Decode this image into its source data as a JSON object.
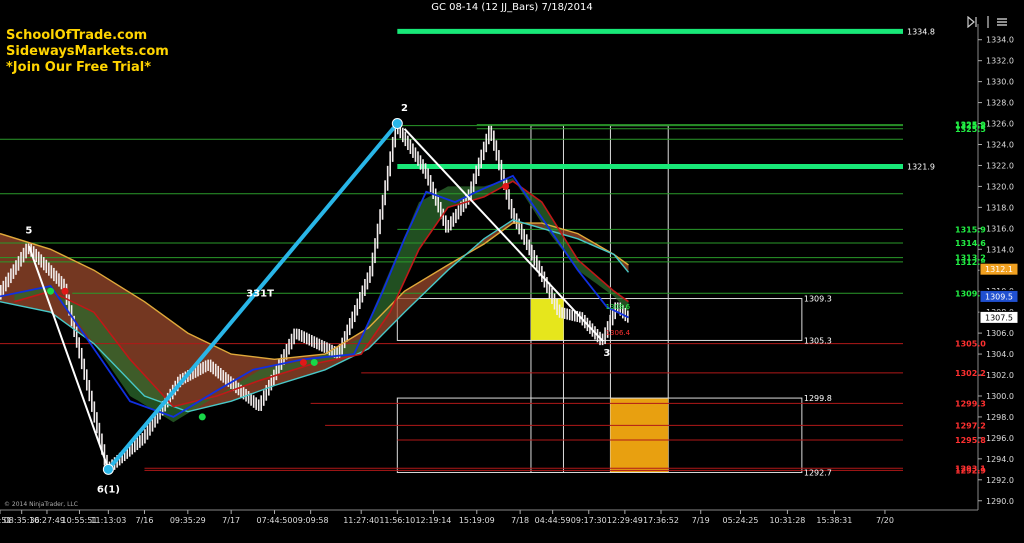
{
  "window": {
    "title": "GC 08-14 (12 JJ_Bars) 7/18/2014"
  },
  "promo": {
    "line1": "SchoolOfTrade.com",
    "line2": "SidewaysMarkets.com",
    "line3": "*Join Our Free Trial*"
  },
  "copyright": "© 2014 NinjaTrader, LLC",
  "toolbar_icons": [
    "play-bar-icon",
    "split-icon",
    "menu-icon"
  ],
  "colors": {
    "background": "#000000",
    "bar": "#f2eded",
    "price_line_white": "#ffffff",
    "wave_blue": "#29b6e8",
    "ribbon_band": "#9b4a2c",
    "envelope_upper": "#e0a93a",
    "envelope_lower": "#48c8c8",
    "fast_ma_red": "#c01818",
    "fast_ma_blue": "#1030e0",
    "green_level": "#18e878",
    "resistance_line": "#2a9a2a",
    "support_line": "#b01818",
    "supply_zone": "#e6e61c",
    "demand_zone": "#e8a010"
  },
  "chart_data": {
    "type": "line",
    "title": "GC 08-14 (12 JJ_Bars) 7/18/2014",
    "xlabel": "",
    "ylabel": "",
    "ylim": [
      1289.5,
      1335.5
    ],
    "y_ticks": [
      1290.0,
      1292.0,
      1294.0,
      1296.0,
      1298.0,
      1300.0,
      1302.0,
      1304.0,
      1306.0,
      1308.0,
      1310.0,
      1312.0,
      1314.0,
      1316.0,
      1318.0,
      1320.0,
      1322.0,
      1324.0,
      1326.0,
      1328.0,
      1330.0,
      1332.0,
      1334.0
    ],
    "x_tick_labels": [
      "56:51",
      "08:35:36",
      "10:27:49",
      "10:55:51",
      "11:13:03",
      "7/16",
      "09:35:29",
      "7/17",
      "07:44:50",
      "09:09:58",
      "11:27:40",
      "11:56:10",
      "12:19:14",
      "15:19:09",
      "7/18",
      "04:44:59",
      "09:17:30",
      "12:29:49",
      "17:36:52",
      "7/19",
      "05:24:25",
      "10:31:28",
      "15:38:31",
      "7/20"
    ],
    "x_tick_index": [
      0,
      6,
      13,
      22,
      30,
      40,
      52,
      64,
      76,
      86,
      100,
      110,
      120,
      132,
      144,
      153,
      163,
      173,
      183,
      194,
      205,
      218,
      231,
      245
    ],
    "x_range": [
      0,
      250
    ],
    "grid": false,
    "legend": "none",
    "series": [
      {
        "points": [
          [
            0,
            1309.7
          ],
          [
            8,
            1314.2
          ],
          [
            18,
            1310.5
          ],
          [
            30,
            1293.0
          ],
          [
            40,
            1296.0
          ],
          [
            50,
            1301.5
          ],
          [
            58,
            1303.0
          ],
          [
            72,
            1299.0
          ],
          [
            82,
            1306.0
          ],
          [
            94,
            1304.0
          ],
          [
            103,
            1312.0
          ],
          [
            110,
            1325.8
          ],
          [
            118,
            1321.5
          ],
          [
            124,
            1316.0
          ],
          [
            130,
            1319.0
          ],
          [
            136,
            1325.5
          ],
          [
            142,
            1317.5
          ],
          [
            149,
            1312.5
          ],
          [
            155,
            1308.0
          ],
          [
            161,
            1307.5
          ],
          [
            167,
            1305.2
          ],
          [
            171,
            1308.6
          ],
          [
            174,
            1307.5
          ]
        ]
      },
      {
        "points": [
          [
            4,
            1309.8
          ],
          [
            14,
            1310.5
          ],
          [
            26,
            1305.0
          ],
          [
            36,
            1300.0
          ],
          [
            48,
            1297.5
          ],
          [
            60,
            1300.0
          ],
          [
            72,
            1302.5
          ],
          [
            86,
            1303.5
          ],
          [
            100,
            1305.5
          ],
          [
            108,
            1312.0
          ],
          [
            116,
            1318.5
          ],
          [
            124,
            1320.0
          ],
          [
            134,
            1320.0
          ],
          [
            142,
            1320.8
          ],
          [
            150,
            1316.5
          ],
          [
            160,
            1312.0
          ],
          [
            170,
            1309.5
          ],
          [
            174,
            1308.0
          ]
        ]
      },
      {
        "points": [
          [
            4,
            1309.0
          ],
          [
            14,
            1310.0
          ],
          [
            26,
            1308.0
          ],
          [
            36,
            1303.5
          ],
          [
            48,
            1299.0
          ],
          [
            60,
            1300.0
          ],
          [
            72,
            1301.5
          ],
          [
            86,
            1303.0
          ],
          [
            100,
            1304.0
          ],
          [
            108,
            1308.0
          ],
          [
            116,
            1314.0
          ],
          [
            124,
            1318.0
          ],
          [
            134,
            1319.0
          ],
          [
            142,
            1320.5
          ],
          [
            150,
            1318.5
          ],
          [
            160,
            1313.0
          ],
          [
            170,
            1310.0
          ],
          [
            174,
            1309.0
          ]
        ]
      },
      {
        "points": [
          [
            0,
            1315.5
          ],
          [
            14,
            1314.0
          ],
          [
            26,
            1312.0
          ],
          [
            40,
            1309.0
          ],
          [
            52,
            1306.0
          ],
          [
            64,
            1304.0
          ],
          [
            76,
            1303.5
          ],
          [
            90,
            1304.0
          ],
          [
            102,
            1306.5
          ],
          [
            112,
            1310.0
          ],
          [
            124,
            1312.5
          ],
          [
            134,
            1314.5
          ],
          [
            142,
            1316.5
          ],
          [
            150,
            1316.5
          ],
          [
            160,
            1315.5
          ],
          [
            170,
            1313.5
          ],
          [
            174,
            1312.5
          ]
        ]
      },
      {
        "points": [
          [
            0,
            1309.0
          ],
          [
            14,
            1308.0
          ],
          [
            26,
            1305.0
          ],
          [
            40,
            1300.0
          ],
          [
            52,
            1298.5
          ],
          [
            64,
            1299.5
          ],
          [
            76,
            1301.0
          ],
          [
            90,
            1302.5
          ],
          [
            102,
            1304.5
          ],
          [
            112,
            1308.0
          ],
          [
            124,
            1312.0
          ],
          [
            134,
            1315.0
          ],
          [
            142,
            1316.8
          ],
          [
            150,
            1316.0
          ],
          [
            160,
            1315.0
          ],
          [
            170,
            1313.5
          ],
          [
            174,
            1311.8
          ]
        ]
      },
      {
        "points": [
          [
            0,
            1309.5
          ],
          [
            14,
            1310.5
          ],
          [
            24,
            1305.5
          ],
          [
            36,
            1299.5
          ],
          [
            48,
            1298.0
          ],
          [
            60,
            1300.5
          ],
          [
            70,
            1302.5
          ],
          [
            84,
            1303.5
          ],
          [
            98,
            1304.0
          ],
          [
            106,
            1310.0
          ],
          [
            112,
            1315.0
          ],
          [
            118,
            1319.5
          ],
          [
            126,
            1318.5
          ],
          [
            132,
            1319.5
          ],
          [
            142,
            1321.0
          ],
          [
            150,
            1317.0
          ],
          [
            160,
            1312.0
          ],
          [
            168,
            1308.5
          ],
          [
            174,
            1307.5
          ]
        ]
      },
      {
        "points": [
          [
            8,
            1314.3
          ],
          [
            30,
            1293.0
          ]
        ]
      },
      {
        "points": [
          [
            30,
            1293.0
          ],
          [
            110,
            1326.0
          ]
        ]
      },
      {
        "points": [
          [
            112,
            1325.5
          ],
          [
            167,
            1305.2
          ]
        ]
      }
    ],
    "annotations": [
      {
        "text": "5",
        "x": 8,
        "y": 1315.5
      },
      {
        "text": "6(1)",
        "x": 30,
        "y": 1290.8
      },
      {
        "text": "331T",
        "x": 72,
        "y": 1309.5
      },
      {
        "text": "2",
        "x": 112,
        "y": 1327.2
      },
      {
        "text": "3",
        "x": 168,
        "y": 1303.8
      }
    ],
    "levels": [
      {
        "value": 1334.8,
        "label": "1334.8",
        "start": 110
      },
      {
        "value": 1321.9,
        "label": "1321.9",
        "start": 110
      }
    ],
    "horizontal_lines": [
      {
        "value": 1325.8,
        "start": 110,
        "label": "1325.8"
      },
      {
        "value": 1325.5,
        "start": 132,
        "label": "1325.5"
      },
      {
        "value": 1325.9,
        "start": 132,
        "label": "1325.9"
      },
      {
        "value": 1324.5,
        "start": 0,
        "label": ""
      },
      {
        "value": 1319.3,
        "start": 0,
        "label": ""
      },
      {
        "value": 1315.9,
        "start": 110,
        "label": "1315.9"
      },
      {
        "value": 1314.6,
        "start": 0,
        "label": "1314.6"
      },
      {
        "value": 1313.2,
        "start": 0,
        "label": "1313.2"
      },
      {
        "value": 1312.8,
        "start": 0,
        "label": "1312.8"
      },
      {
        "value": 1309.8,
        "start": 20,
        "label": "1309.8"
      },
      {
        "value": 1305.0,
        "start": 0,
        "label": "1305.0"
      },
      {
        "value": 1302.2,
        "start": 100,
        "label": "1302.2"
      },
      {
        "value": 1299.3,
        "start": 86,
        "label": "1299.3"
      },
      {
        "value": 1297.2,
        "start": 90,
        "label": "1297.2"
      },
      {
        "value": 1295.8,
        "start": 110,
        "label": "1295.8"
      },
      {
        "value": 1293.1,
        "start": 40,
        "label": "1293.1"
      },
      {
        "value": 1292.9,
        "start": 40,
        "label": "1292.9"
      }
    ],
    "zone_boxes": [
      {
        "top": 1309.3,
        "bottom": 1305.3,
        "start": 110,
        "end": 222,
        "label_top": "1309.3",
        "label_bottom": "1305.3"
      },
      {
        "top": 1299.8,
        "bottom": 1292.7,
        "start": 110,
        "end": 222,
        "label_top": "1299.8",
        "label_bottom": "1292.7"
      }
    ],
    "columns": [
      {
        "top": 1325.8,
        "bottom": 1292.7,
        "start": 147,
        "end": 156
      },
      {
        "top": 1325.8,
        "bottom": 1292.7,
        "start": 169,
        "end": 185
      }
    ],
    "filled_zones": [
      {
        "top": 1309.3,
        "bottom": 1305.3,
        "start": 147,
        "end": 156,
        "color": "#e6e61c"
      },
      {
        "top": 1299.8,
        "bottom": 1292.7,
        "start": 169,
        "end": 185,
        "color": "#e8a010"
      }
    ],
    "price_tags": [
      {
        "value": 1312.1,
        "label": "1312.1",
        "color": "#f0a020"
      },
      {
        "value": 1309.5,
        "label": "1309.5",
        "color": "#2050d0"
      },
      {
        "value": 1307.5,
        "label": "1307.5",
        "color": "#ffffff"
      }
    ],
    "inline_labels": [
      {
        "text": "1308.6",
        "x": 166,
        "y": 1308.6
      },
      {
        "text": "1306.4",
        "x": 166,
        "y": 1306.1
      }
    ],
    "markers": [
      {
        "x": 14,
        "y": 1310.0,
        "color": "#18d848"
      },
      {
        "x": 18,
        "y": 1310.0,
        "color": "#e01818"
      },
      {
        "x": 56,
        "y": 1298.0,
        "color": "#18d848"
      },
      {
        "x": 84,
        "y": 1303.2,
        "color": "#e01818"
      },
      {
        "x": 87,
        "y": 1303.2,
        "color": "#18d848"
      },
      {
        "x": 140,
        "y": 1320.0,
        "color": "#e01818"
      }
    ],
    "wave_endpoints": [
      {
        "x": 30,
        "y": 1293.0
      },
      {
        "x": 110,
        "y": 1326.0
      }
    ]
  }
}
